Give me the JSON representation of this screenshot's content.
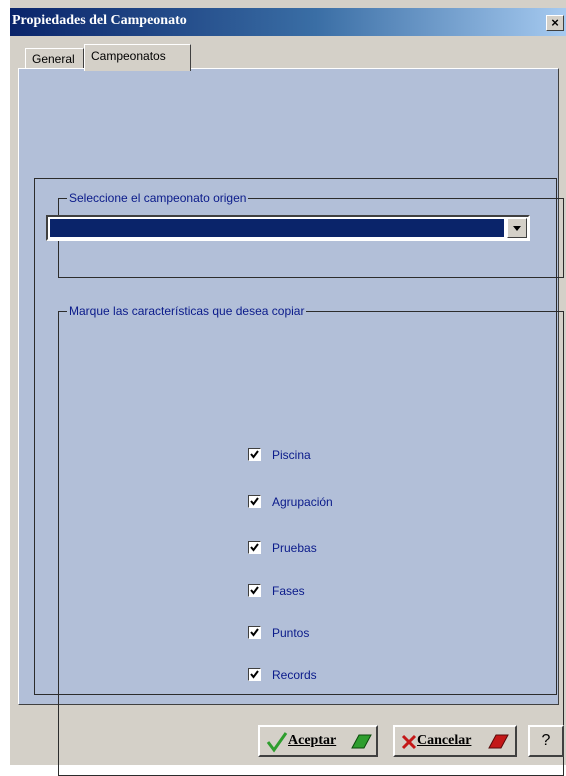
{
  "window": {
    "title": "Propiedades del Campeonato",
    "close_label": "×"
  },
  "tabs": [
    {
      "label": "General",
      "active": false
    },
    {
      "label": "Campeonatos",
      "active": true
    }
  ],
  "source_group": {
    "legend": "Seleccione el campeonato origen",
    "dropdown_value": ""
  },
  "copy_group": {
    "legend": "Marque las características que desea copiar",
    "options": [
      {
        "label": "Piscina",
        "checked": true
      },
      {
        "label": "Agrupación",
        "checked": true
      },
      {
        "label": "Pruebas",
        "checked": true
      },
      {
        "label": "Fases",
        "checked": true
      },
      {
        "label": "Puntos",
        "checked": true
      },
      {
        "label": "Records",
        "checked": true
      }
    ]
  },
  "buttons": {
    "accept": "Aceptar",
    "cancel": "Cancelar",
    "help": "?"
  },
  "colors": {
    "panel": "#b2bfd8",
    "title_bar": "#0a246a",
    "label_text": "#0a1a8a",
    "accept_icon": "#2e9e2e",
    "cancel_icon": "#c41818"
  }
}
